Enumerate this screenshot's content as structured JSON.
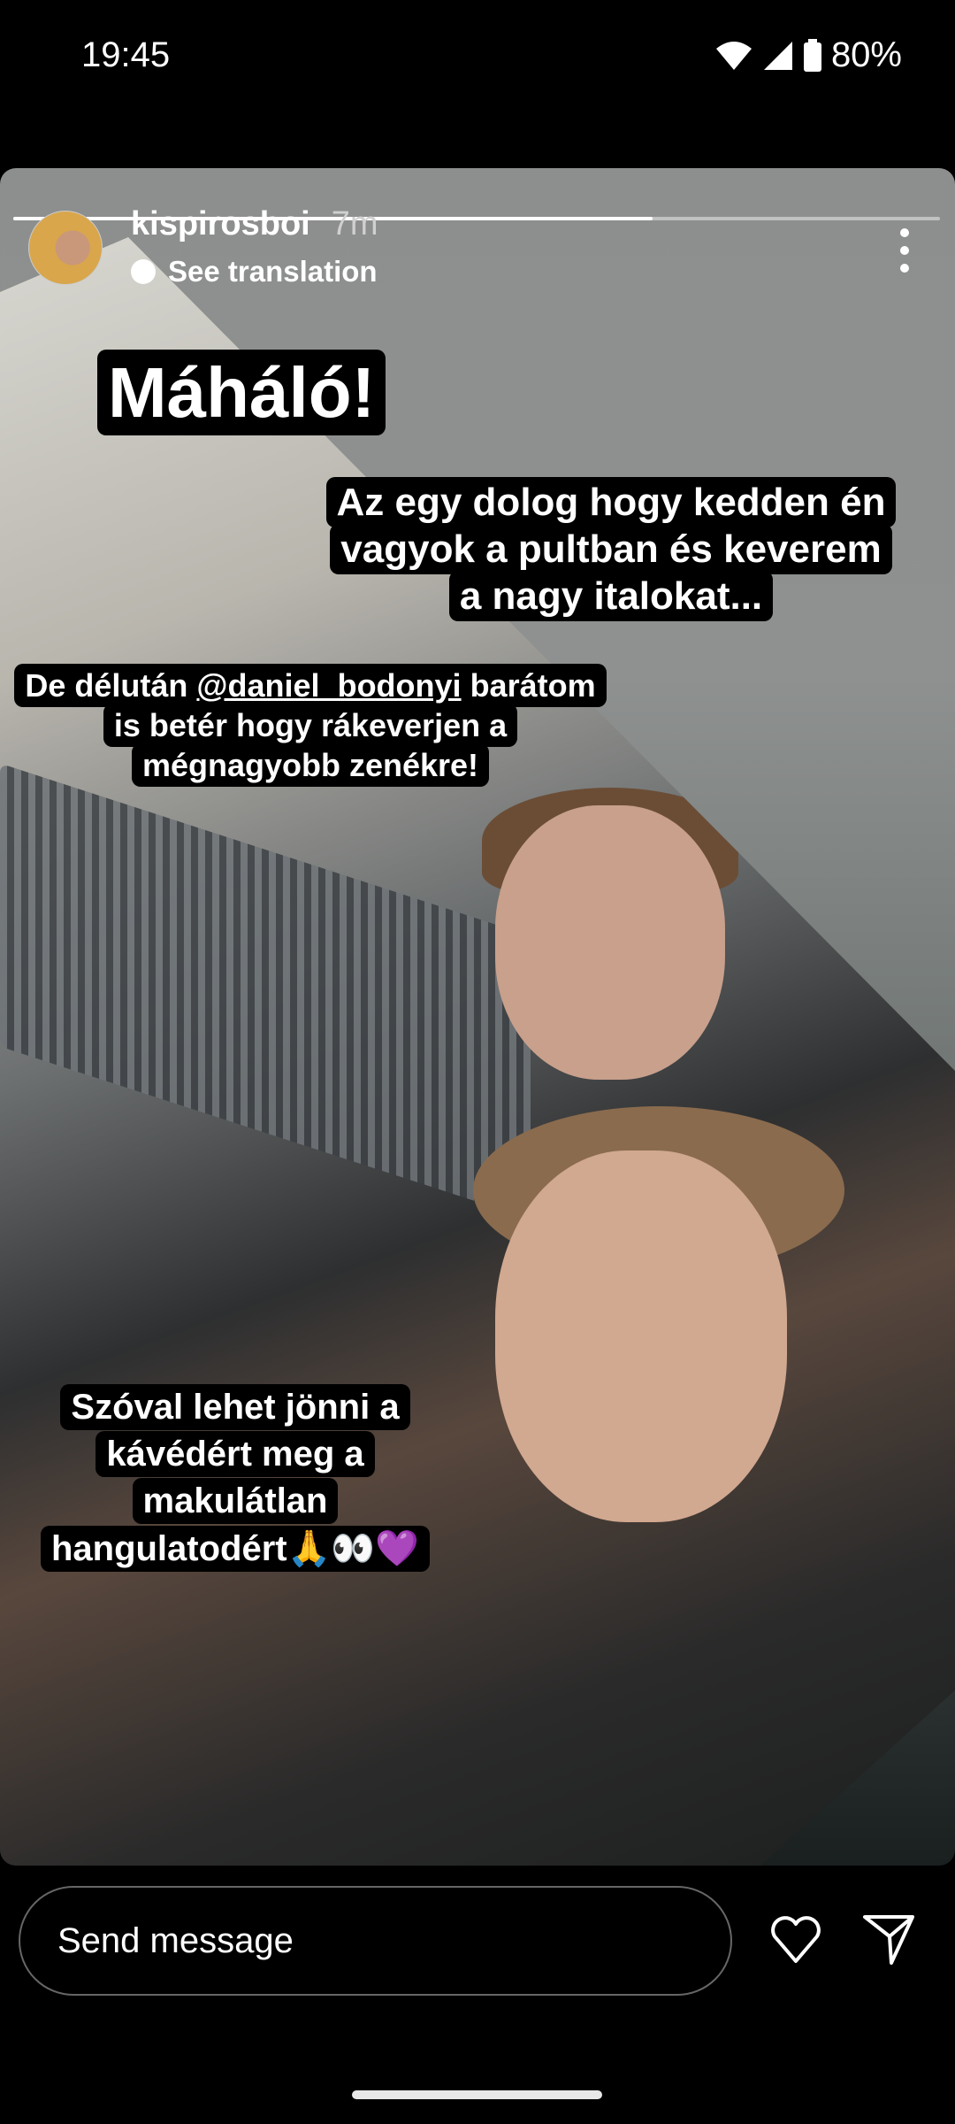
{
  "status_bar": {
    "time": "19:45",
    "battery": "80%",
    "icons": [
      "wifi-icon",
      "signal-icon",
      "battery-icon"
    ]
  },
  "story": {
    "progress": 0.69,
    "username": "kispirosboi",
    "age": "7m",
    "see_translation": "See translation",
    "captions": {
      "title": "Máháló!",
      "c2": [
        "Az egy dolog hogy kedden én",
        "vagyok a pultban és keverem",
        "a nagy italokat..."
      ],
      "c3_pre": "De délután ",
      "c3_mention": "@daniel_bodonyi",
      "c3_post": " barátom",
      "c3": [
        "is betér hogy rákeverjen a",
        "mégnagyobb zenékre!"
      ],
      "c4": [
        "Szóval lehet jönni a",
        "kávédért meg a",
        "makulátlan",
        "hangulatodért🙏👀💜"
      ]
    }
  },
  "reply": {
    "placeholder": "Send message"
  }
}
